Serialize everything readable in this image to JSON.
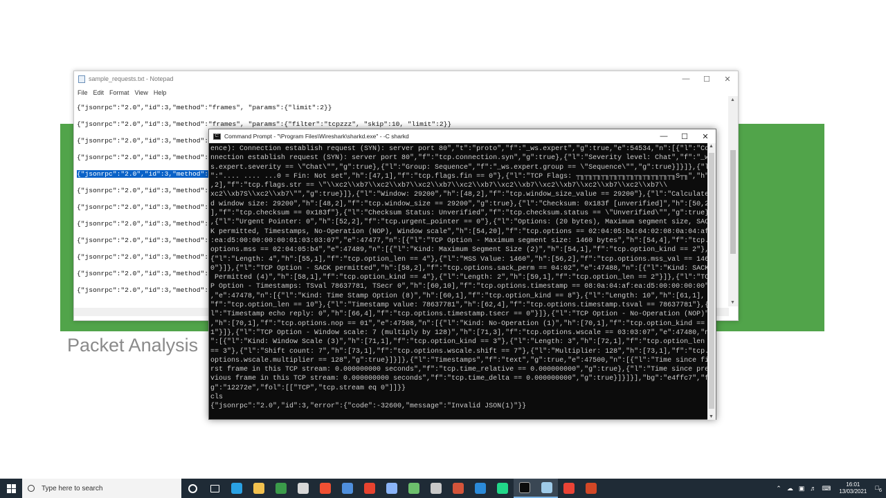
{
  "slide": {
    "title": "Packet Analysis"
  },
  "notepad": {
    "title": "sample_requests.txt - Notepad",
    "menu": [
      "File",
      "Edit",
      "Format",
      "View",
      "Help"
    ],
    "lines": [
      "{\"jsonrpc\":\"2.0\",\"id\":3,\"method\":\"frames\", \"params\":{\"limit\":2}}",
      "{\"jsonrpc\":\"2.0\",\"id\":3,\"method\":\"frames\", \"params\":{\"filter\":\"tcpzzz\", \"skip\":10, \"limit\":2}}",
      "{\"jsonrpc\":\"2.0\",\"id\":3,\"method\":\"ta",
      "{\"jsonrpc\":\"2.0\",\"id\":3,\"method\":\"fo",
      "{\"jsonrpc\":\"2.0\",\"id\":3,\"method\":\"fr",
      "{\"jsonrpc\":\"2.0\",\"id\":3,\"method\":\"ta",
      "{\"jsonrpc\":\"2.0\",\"id\":3,\"method\":\"do",
      "{\"jsonrpc\":\"2.0\",\"id\":3,\"method\":\"io",
      "{\"jsonrpc\":\"2.0\",\"id\":3,\"method\":\"in",
      "{\"jsonrpc\":\"2.0\",\"id\":3,\"method\":\"in",
      "{\"jsonrpc\":\"2.0\",\"id\":3,\"method\":\"co",
      "{\"jsonrpc\":\"2.0\",\"id\":3,\"method\":\"co"
    ],
    "selected_line": 4
  },
  "cmd": {
    "title": "Command Prompt - \"\\Program Files\\Wireshark\\sharkd.exe\"  - -C sharkd",
    "lines": [
      "ence): Connection establish request (SYN): server port 80\",\"t\":\"proto\",\"f\":\"_ws.expert\",\"g\":true,\"e\":54534,\"n\":[{\"l\":\"Co",
      "nnection establish request (SYN): server port 80\",\"f\":\"tcp.connection.syn\",\"g\":true},{\"l\":\"Severity level: Chat\",\"f\":\"_w",
      "s.expert.severity == \\\"Chat\\\"\",\"g\":true},{\"l\":\"Group: Sequence\",\"f\":\"_ws.expert.group == \\\"Sequence\\\"\",\"g\":true}]}]},{\"l",
      "\":\".... .... ...0 = Fin: Not set\",\"h\":[47,1],\"f\":\"tcp.flags.fin == 0\"},{\"l\":\"TCP Flags: ┬╖┬╖┬╖┬╖┬╖┬╖┬╖┬╖┬╖┬╖┬╖┬╖S┬╖\",\"h\":[46",
      ",2],\"f\":\"tcp.flags.str == \\\"\\\\xc2\\\\xb7\\\\xc2\\\\xb7\\\\xc2\\\\xb7\\\\xc2\\\\xb7\\\\xc2\\\\xb7\\\\xc2\\\\xb7\\\\xc2\\\\xb7\\\\xc2\\\\xb7\\\\",
      "xc2\\\\xb7S\\\\xc2\\\\xb7\\\"\",\"g\":true}]},{\"l\":\"Window: 29200\",\"h\":[48,2],\"f\":\"tcp.window_size_value == 29200\"},{\"l\":\"Calculate",
      "d window size: 29200\",\"h\":[48,2],\"f\":\"tcp.window_size == 29200\",\"g\":true},{\"l\":\"Checksum: 0x183f [unverified]\",\"h\":[50,2",
      "],\"f\":\"tcp.checksum == 0x183f\"},{\"l\":\"Checksum Status: Unverified\",\"f\":\"tcp.checksum.status == \\\"Unverified\\\"\",\"g\":true}",
      ",{\"l\":\"Urgent Pointer: 0\",\"h\":[52,2],\"f\":\"tcp.urgent_pointer == 0\"},{\"l\":\"Options: (20 bytes), Maximum segment size, SAC",
      "K permitted, Timestamps, No-Operation (NOP), Window scale\",\"h\":[54,20],\"f\":\"tcp.options == 02:04:05:b4:04:02:08:0a:04:af",
      ":ea:d5:00:00:00:00:01:03:03:07\",\"e\":47477,\"n\":[{\"l\":\"TCP Option - Maximum segment size: 1460 bytes\",\"h\":[54,4],\"f\":\"tcp.",
      "options.mss == 02:04:05:b4\",\"e\":47489,\"n\":[{\"l\":\"Kind: Maximum Segment Size (2)\",\"h\":[54,1],\"f\":\"tcp.option_kind == 2\"},",
      "{\"l\":\"Length: 4\",\"h\":[55,1],\"f\":\"tcp.option_len == 4\"},{\"l\":\"MSS Value: 1460\",\"h\":[56,2],\"f\":\"tcp.options.mss_val == 146",
      "0\"}]},{\"l\":\"TCP Option - SACK permitted\",\"h\":[58,2],\"f\":\"tcp.options.sack_perm == 04:02\",\"e\":47488,\"n\":[{\"l\":\"Kind: SACK",
      " Permitted (4)\",\"h\":[58,1],\"f\":\"tcp.option_kind == 4\"},{\"l\":\"Length: 2\",\"h\":[59,1],\"f\":\"tcp.option_len == 2\"}]},{\"l\":\"TC",
      "P Option - Timestamps: TSval 78637781, TSecr 0\",\"h\":[60,10],\"f\":\"tcp.options.timestamp == 08:0a:04:af:ea:d5:00:00:00:00\"",
      ",\"e\":47478,\"n\":[{\"l\":\"Kind: Time Stamp Option (8)\",\"h\":[60,1],\"f\":\"tcp.option_kind == 8\"},{\"l\":\"Length: 10\",\"h\":[61,1],",
      "\"f\":\"tcp.option_len == 10\"},{\"l\":\"Timestamp value: 78637781\",\"h\":[62,4],\"f\":\"tcp.options.timestamp.tsval == 78637781\"},{\"",
      "l\":\"Timestamp echo reply: 0\",\"h\":[66,4],\"f\":\"tcp.options.timestamp.tsecr == 0\"}]},{\"l\":\"TCP Option - No-Operation (NOP)\"",
      ",\"h\":[70,1],\"f\":\"tcp.options.nop == 01\",\"e\":47508,\"n\":[{\"l\":\"Kind: No-Operation (1)\",\"h\":[70,1],\"f\":\"tcp.option_kind ==",
      "1\"}]},{\"l\":\"TCP Option - Window scale: 7 (multiply by 128)\",\"h\":[71,3],\"f\":\"tcp.options.wscale == 03:03:07\",\"e\":47480,\"n",
      "\":[{\"l\":\"Kind: Window Scale (3)\",\"h\":[71,1],\"f\":\"tcp.option_kind == 3\"},{\"l\":\"Length: 3\",\"h\":[72,1],\"f\":\"tcp.option_len",
      "== 3\"},{\"l\":\"Shift count: 7\",\"h\":[73,1],\"f\":\"tcp.options.wscale.shift == 7\"},{\"l\":\"Multiplier: 128\",\"h\":[73,1],\"f\":\"tcp.",
      "options.wscale.multiplier == 128\",\"g\":true}]}]},{\"l\":\"Timestamps\",\"f\":\"text\",\"g\":true,\"e\":47500,\"n\":[{\"l\":\"Time since fi",
      "rst frame in this TCP stream: 0.000000000 seconds\",\"f\":\"tcp.time_relative == 0.000000000\",\"g\":true},{\"l\":\"Time since pre",
      "vious frame in this TCP stream: 0.000000000 seconds\",\"f\":\"tcp.time_delta == 0.000000000\",\"g\":true}]}]}],\"bg\":\"e4ffc7\",\"f",
      "g\":\"12272e\",\"fol\":[[\"TCP\",\"tcp.stream eq 0\"]]}}",
      "cls",
      "{\"jsonrpc\":\"2.0\",\"id\":3,\"error\":{\"code\":-32600,\"message\":\"Invalid JSON(1)\"}}",
      ""
    ]
  },
  "taskbar": {
    "search_placeholder": "Type here to search",
    "time": "16:01",
    "date": "13/03/2021",
    "notification_count": "6",
    "pinned_icons": [
      "cortana-icon",
      "task-view-icon",
      "edge-icon",
      "file-explorer-icon",
      "chrome-green-icon",
      "obs-icon",
      "git-icon",
      "store-icon",
      "red-app-icon",
      "photos-icon",
      "taskmgr-icon",
      "putty-icon",
      "git-gui-icon",
      "vscode-icon",
      "pycharm-icon",
      "cmd-icon",
      "notepad-icon",
      "chrome-icon",
      "powerpoint-icon"
    ]
  }
}
